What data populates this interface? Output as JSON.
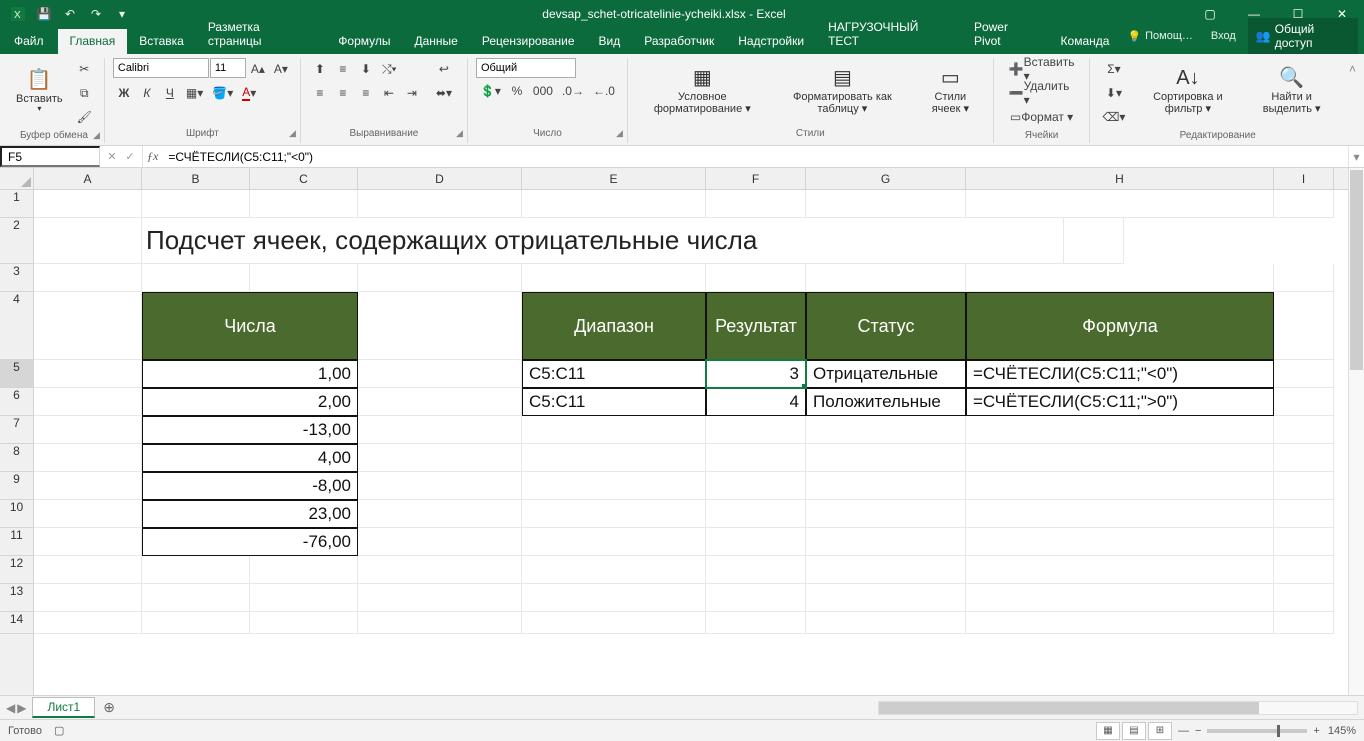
{
  "titlebar": {
    "doc": "devsap_schet-otricatelinie-ycheiki.xlsx - Excel"
  },
  "tabs": {
    "file": "Файл",
    "items": [
      "Главная",
      "Вставка",
      "Разметка страницы",
      "Формулы",
      "Данные",
      "Рецензирование",
      "Вид",
      "Разработчик",
      "Надстройки",
      "НАГРУЗОЧНЫЙ ТЕСТ",
      "Power Pivot",
      "Команда"
    ],
    "active_index": 0,
    "tell_me": "Помощ…",
    "signin": "Вход",
    "share": "Общий доступ"
  },
  "ribbon": {
    "paste": "Вставить",
    "clipboard": "Буфер обмена",
    "font_name": "Calibri",
    "font_size": "11",
    "font_group": "Шрифт",
    "align_group": "Выравнивание",
    "number_format": "Общий",
    "number_group": "Число",
    "cond_fmt": "Условное форматирование ▾",
    "fmt_table": "Форматировать как таблицу ▾",
    "cell_styles": "Стили ячеек ▾",
    "styles_group": "Стили",
    "insert_cells": "Вставить ▾",
    "delete_cells": "Удалить ▾",
    "format_cells": "Формат ▾",
    "cells_group": "Ячейки",
    "sort_filter": "Сортировка и фильтр ▾",
    "find_select": "Найти и выделить ▾",
    "editing_group": "Редактирование"
  },
  "formula_bar": {
    "namebox": "F5",
    "formula": "=СЧЁТЕСЛИ(C5:C11;\"<0\")"
  },
  "columns": [
    "A",
    "B",
    "C",
    "D",
    "E",
    "F",
    "G",
    "H",
    "I"
  ],
  "rows": [
    "1",
    "2",
    "3",
    "4",
    "5",
    "6",
    "7",
    "8",
    "9",
    "10",
    "11",
    "12",
    "13",
    "14"
  ],
  "sheet": {
    "title": "Подсчет ячеек, содержащих отрицательные числа",
    "numbers_header": "Числа",
    "numbers": [
      "1,00",
      "2,00",
      "-13,00",
      "4,00",
      "-8,00",
      "23,00",
      "-76,00"
    ],
    "table_headers": [
      "Диапазон",
      "Результат",
      "Статус",
      "Формула"
    ],
    "table_rows": [
      {
        "range": "C5:C11",
        "result": "3",
        "status": "Отрицательные",
        "formula": "=СЧЁТЕСЛИ(C5:C11;\"<0\")"
      },
      {
        "range": "C5:C11",
        "result": "4",
        "status": "Положительные",
        "formula": "=СЧЁТЕСЛИ(C5:C11;\">0\")"
      }
    ]
  },
  "sheet_tab": "Лист1",
  "status": {
    "ready": "Готово",
    "zoom": "145%"
  }
}
